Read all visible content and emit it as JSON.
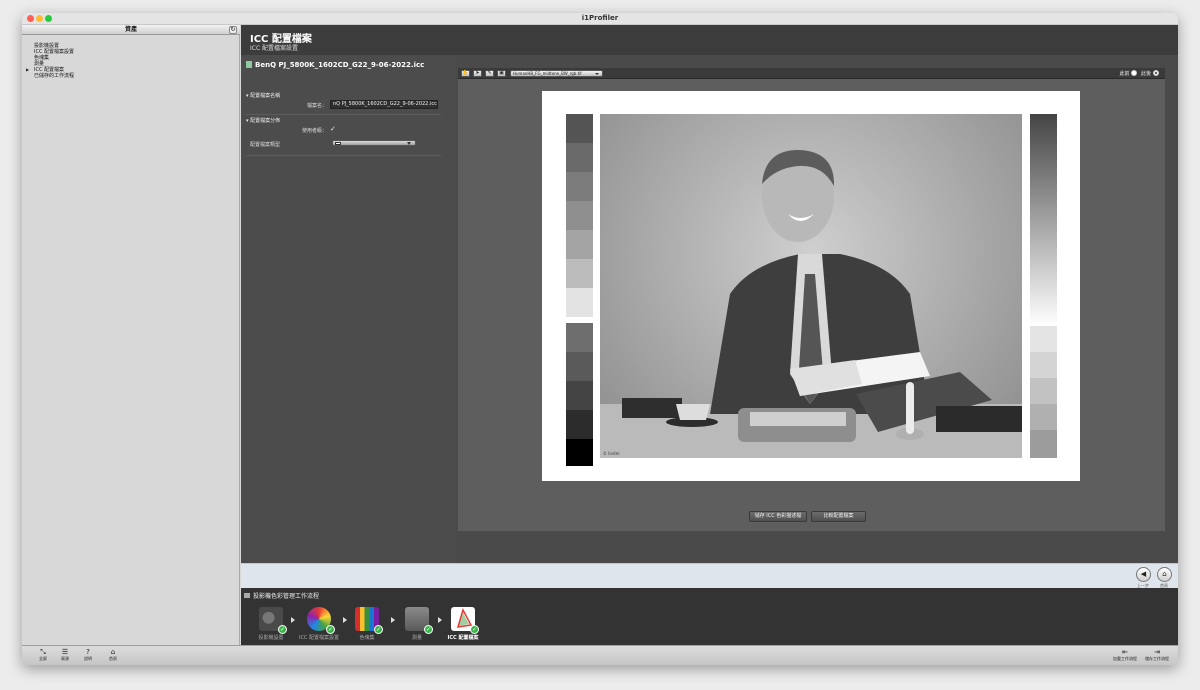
{
  "window": {
    "title": "i1Profiler"
  },
  "sidebar": {
    "header": "資產",
    "items": [
      {
        "label": "投影機設置",
        "active": false
      },
      {
        "label": "ICC 配置檔案設置",
        "active": false
      },
      {
        "label": "色塊集",
        "active": false
      },
      {
        "label": "測量",
        "active": false
      },
      {
        "label": "ICC 配置檔案",
        "active": true
      },
      {
        "label": "已儲存的工作流程",
        "active": false
      }
    ]
  },
  "header": {
    "title": "ICC 配置檔案",
    "subtitle": "ICC 配置檔案設置"
  },
  "left_panel": {
    "file_name": "BenQ PJ_5800K_1602CD_G22_9-06-2022.icc",
    "section_name": "配置檔案名稱",
    "file_name_label": "檔案名：",
    "file_name_value": "nQ PJ_5800K_1602CD_G22_9-06-2022.icc",
    "section_distribution": "配置檔案分佈",
    "use_label": "使用者級：",
    "use_checked": "✓",
    "profile_type_label": "配置檔案類型"
  },
  "preview": {
    "image_select": "HumanHB_FG_midtone_BW_rgb.tif",
    "radio_before": "此前",
    "radio_after": "此後",
    "save_button": "儲存 ICC 色彩描述檔",
    "compare_button": "比較配置檔案",
    "photo_credit": "© lindm"
  },
  "nav": {
    "back_label": "上一步",
    "home_label": "首頁"
  },
  "workflow": {
    "title": "投影機色彩管理工作流程",
    "steps": [
      {
        "label": "投影機設置"
      },
      {
        "label": "ICC 配置檔案設置"
      },
      {
        "label": "色塊集"
      },
      {
        "label": "測量"
      },
      {
        "label": "ICC 配置檔案"
      }
    ]
  },
  "bottom_bar": {
    "fullscreen": "全屏",
    "assets": "資源",
    "help": "說明",
    "home": "首頁",
    "load_workflow": "加載工作流程",
    "save_workflow": "儲存工作流程"
  },
  "colors": {
    "check_green": "#3bb54a",
    "panel_dark": "#4a4a4a",
    "nav_bar": "#dfe5ec"
  }
}
